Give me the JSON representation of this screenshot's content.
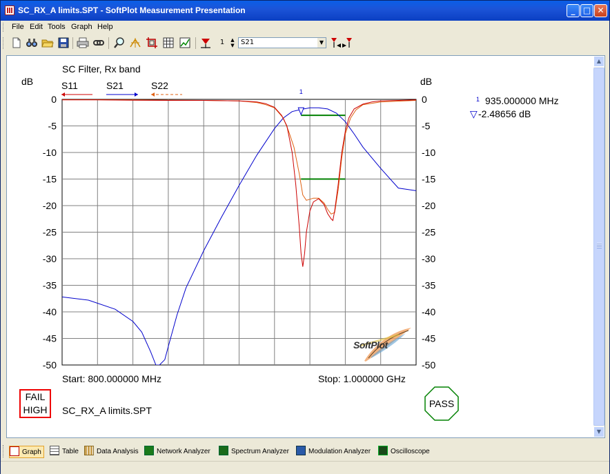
{
  "window": {
    "title": "SC_RX_A limits.SPT - SoftPlot Measurement Presentation",
    "minimize_glyph": "_",
    "maximize_glyph": "□",
    "close_glyph": "✕"
  },
  "menu": [
    "File",
    "Edit",
    "Tools",
    "Graph",
    "Help"
  ],
  "toolbar": {
    "trace_number": "1",
    "trace_select": "S21",
    "icons": [
      "new-icon",
      "binoculars-icon",
      "open-folder-icon",
      "save-icon",
      "print-icon",
      "link-icon",
      "zoom-icon",
      "marker-search-icon",
      "crop-icon",
      "grid-icon",
      "autoscale-icon",
      "marker-icon",
      "marker-prev-icon",
      "marker-next-icon"
    ]
  },
  "graph": {
    "title": "SC Filter, Rx band",
    "left_unit": "dB",
    "right_unit": "dB",
    "legend": [
      {
        "name": "S11",
        "color": "#cc0000"
      },
      {
        "name": "S21",
        "color": "#0000cc"
      },
      {
        "name": "S22",
        "color": "#e06010"
      }
    ],
    "start_label": "Start: 800.000000 MHz",
    "stop_label": "Stop: 1.000000 GHz",
    "marker_freq": "935.000000 MHz",
    "marker_value": "-2.48656 dB",
    "marker_number": "1",
    "filename": "SC_RX_A limits.SPT",
    "fail_line1": "FAIL",
    "fail_line2": "HIGH",
    "pass_label": "PASS",
    "logo_text": "SoftPlot"
  },
  "chart_data": {
    "type": "line",
    "title": "SC Filter, Rx band",
    "ylabel": "dB",
    "xlim": [
      800,
      1000
    ],
    "ylim": [
      -50,
      0
    ],
    "x_ticks_count": 10,
    "y_ticks": [
      "0",
      "-5",
      "-10",
      "-15",
      "-20",
      "-25",
      "-30",
      "-35",
      "-40",
      "-45",
      "-50"
    ],
    "grid": true,
    "series": [
      {
        "name": "S11",
        "color": "#cc0000",
        "x": [
          800,
          820,
          840,
          860,
          880,
          900,
          910,
          915,
          920,
          924,
          927,
          930,
          932,
          934,
          935,
          936,
          937,
          938,
          940,
          942,
          945,
          948,
          950,
          952,
          953,
          954,
          956,
          958,
          960,
          962,
          965,
          970,
          975,
          980,
          990,
          1000
        ],
        "y": [
          -0.1,
          -0.1,
          -0.15,
          -0.2,
          -0.2,
          -0.3,
          -0.5,
          -0.8,
          -1.5,
          -3,
          -5,
          -10,
          -16,
          -24,
          -29,
          -31.5,
          -29,
          -25,
          -21,
          -19.3,
          -18.7,
          -19.8,
          -21.5,
          -22.5,
          -22.8,
          -21,
          -16,
          -10,
          -6,
          -3.5,
          -1.8,
          -0.9,
          -0.5,
          -0.3,
          -0.2,
          -0.1
        ]
      },
      {
        "name": "S21",
        "color": "#0000cc",
        "x": [
          800,
          815,
          830,
          840,
          845,
          850,
          853,
          855,
          858,
          860,
          865,
          870,
          880,
          890,
          900,
          910,
          920,
          925,
          930,
          935,
          940,
          945,
          950,
          955,
          960,
          965,
          970,
          980,
          990,
          1000
        ],
        "y": [
          -37.2,
          -37.8,
          -39.5,
          -41.8,
          -43.8,
          -47.5,
          -50,
          -50,
          -49,
          -46.5,
          -40.5,
          -35.5,
          -28.5,
          -22.2,
          -16.2,
          -10.5,
          -5.5,
          -3.5,
          -2.3,
          -1.9,
          -1.6,
          -1.6,
          -1.8,
          -2.6,
          -4.2,
          -6.5,
          -9,
          -13,
          -16.7,
          -17.2
        ]
      },
      {
        "name": "S22",
        "color": "#e06010",
        "x": [
          800,
          840,
          880,
          900,
          910,
          915,
          920,
          925,
          928,
          931,
          934,
          936,
          938,
          940,
          942,
          945,
          948,
          950,
          952,
          954,
          956,
          958,
          960,
          963,
          966,
          970,
          980,
          1000
        ],
        "y": [
          -0.05,
          -0.1,
          -0.2,
          -0.3,
          -0.6,
          -1,
          -1.6,
          -3.5,
          -6,
          -9,
          -14,
          -18,
          -19,
          -18.8,
          -18.6,
          -18.6,
          -19.5,
          -20.7,
          -21.6,
          -21.3,
          -17,
          -11,
          -6.5,
          -3.5,
          -2,
          -1,
          -0.5,
          -0.2
        ]
      }
    ],
    "limit_lines": [
      {
        "x": [
          935,
          960
        ],
        "y": [
          -3,
          -3
        ],
        "color": "#008000"
      },
      {
        "x": [
          935,
          960
        ],
        "y": [
          -15,
          -15
        ],
        "color": "#008000"
      }
    ],
    "marker": {
      "x": 935,
      "y": -2.48656
    }
  },
  "status_tabs": [
    {
      "label": "Graph",
      "icon": "graph-tab-icon",
      "active": true
    },
    {
      "label": "Table",
      "icon": "table-tab-icon",
      "active": false
    },
    {
      "label": "Data Analysis",
      "icon": "data-analysis-tab-icon",
      "active": false
    },
    {
      "label": "Network Analyzer",
      "icon": "network-analyzer-tab-icon",
      "active": false
    },
    {
      "label": "Spectrum Analyzer",
      "icon": "spectrum-analyzer-tab-icon",
      "active": false
    },
    {
      "label": "Modulation Analyzer",
      "icon": "modulation-analyzer-tab-icon",
      "active": false
    },
    {
      "label": "Oscilloscope",
      "icon": "oscilloscope-tab-icon",
      "active": false
    }
  ]
}
